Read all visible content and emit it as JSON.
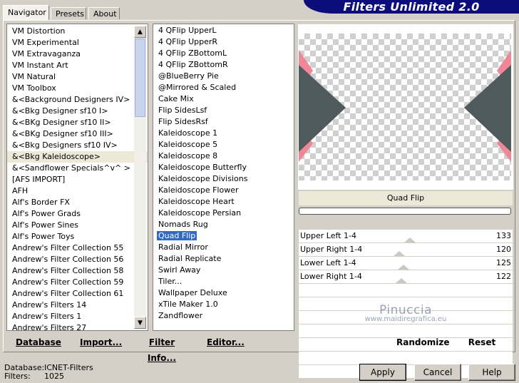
{
  "tabs": [
    {
      "label": "Navigator",
      "active": true
    },
    {
      "label": "Presets",
      "active": false
    },
    {
      "label": "About",
      "active": false
    }
  ],
  "banner": "Filters Unlimited 2.0",
  "categories": [
    "VM Distortion",
    "VM Experimental",
    "VM Extravaganza",
    "VM Instant Art",
    "VM Natural",
    "VM Toolbox",
    "&<Background Designers IV>",
    "&<Bkg Designer sf10 I>",
    "&<BKg Designer sf10 II>",
    "&<BKg Designer sf10 III>",
    "&<Bkg Designers sf10 IV>",
    "&<Bkg Kaleidoscope>",
    "&<Sandflower Specials^v^ >",
    "[AFS IMPORT]",
    "AFH",
    "Alf's Border FX",
    "Alf's Power Grads",
    "Alf's Power Sines",
    "Alf's Power Toys",
    "Andrew's Filter Collection 55",
    "Andrew's Filter Collection 56",
    "Andrew's Filter Collection 58",
    "Andrew's Filter Collection 59",
    "Andrew's Filter Collection 61",
    "Andrew's Filters 14",
    "Andrew's Filters 1",
    "Andrew's Filters 27"
  ],
  "selected_category": "&<Bkg Kaleidoscope>",
  "filters": [
    "4 QFlip UpperL",
    "4 QFlip UpperR",
    "4 QFlip ZBottomL",
    "4 QFlip ZBottomR",
    "@BlueBerry Pie",
    "@Mirrored & Scaled",
    "Cake Mix",
    "Flip SidesLsf",
    "Flip SidesRsf",
    "Kaleidoscope 1",
    "Kaleidoscope 5",
    "Kaleidoscope 8",
    "Kaleidoscope Butterfly",
    "Kaleidoscope Divisions",
    "Kaleidoscope Flower",
    "Kaleidoscope Heart",
    "Kaleidoscope Persian",
    "Nomads Rug",
    "Quad Flip",
    "Radial Mirror",
    "Radial Replicate",
    "Swirl Away",
    "Tiler...",
    "Wallpaper Deluxe",
    "xTile Maker 1.0",
    "Zandflower"
  ],
  "selected_filter": "Quad Flip",
  "preview": {
    "colors": {
      "diamond": "#4f5a5c",
      "pink": "#f08696",
      "checker": "#cfcfcf"
    }
  },
  "filter_name": "Quad Flip",
  "params": [
    {
      "label": "Upper Left 1-4",
      "value": "133",
      "fraction": 0.52
    },
    {
      "label": "Upper Right 1-4",
      "value": "120",
      "fraction": 0.47
    },
    {
      "label": "Lower Left 1-4",
      "value": "125",
      "fraction": 0.49
    },
    {
      "label": "Lower Right 1-4",
      "value": "122",
      "fraction": 0.48
    }
  ],
  "watermark": {
    "line1": "Pinuccia",
    "line2": "www.maidiregrafica.eu"
  },
  "toolbar": {
    "database": "Database",
    "import": "Import...",
    "filter_info": "Filter Info...",
    "editor": "Editor...",
    "randomize": "Randomize",
    "reset": "Reset"
  },
  "status": {
    "database_label": "Database:",
    "database_value": "ICNET-Filters",
    "filters_label": "Filters:",
    "filters_value": "1025"
  },
  "dialog": {
    "apply": "Apply",
    "cancel": "Cancel",
    "help": "Help"
  }
}
